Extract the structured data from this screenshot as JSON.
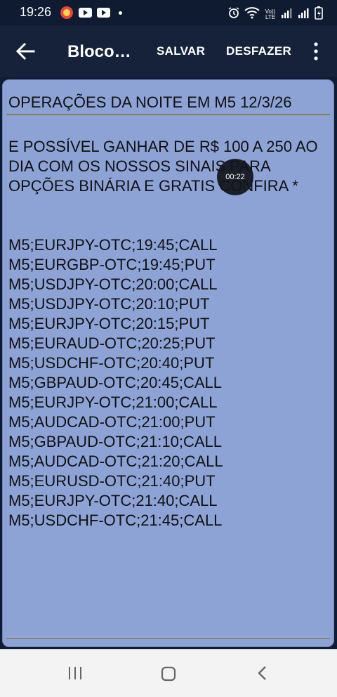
{
  "status_bar": {
    "time": "19:26",
    "signal_label": "Vo)) LTE"
  },
  "app_bar": {
    "title": "Bloco…",
    "save_label": "SALVAR",
    "undo_label": "DESFAZER"
  },
  "note": {
    "title": "OPERAÇÕES DA NOITE EM M5 12/3/26",
    "intro": "E POSSÍVEL GANHAR DE R$ 100 A 250 AO DIA COM OS NOSSOS SINAIS PARA OPÇÕES BINÁRIA E GRATIS CONFIRA *",
    "signals": [
      "M5;EURJPY-OTC;19:45;CALL",
      "M5;EURGBP-OTC;19:45;PUT",
      "M5;USDJPY-OTC;20:00;CALL",
      "M5;USDJPY-OTC;20:10;PUT",
      "M5;EURJPY-OTC;20:15;PUT",
      "M5;EURAUD-OTC;20:25;PUT",
      "M5;USDCHF-OTC;20:40;PUT",
      "M5;GBPAUD-OTC;20:45;CALL",
      "M5;EURJPY-OTC;21:00;CALL",
      "M5;AUDCAD-OTC;21:00;PUT",
      "M5;GBPAUD-OTC;21:10;CALL",
      "M5;AUDCAD-OTC;21:20;CALL",
      "M5;EURUSD-OTC;21:40;PUT",
      "M5;EURJPY-OTC;21:40;CALL",
      "M5;USDCHF-OTC;21:45;CALL"
    ]
  },
  "overlay": {
    "timer": "00:22"
  },
  "colors": {
    "app_bar": "#16213a",
    "paper": "#8ea3d5",
    "rule": "#8a7d4a"
  }
}
